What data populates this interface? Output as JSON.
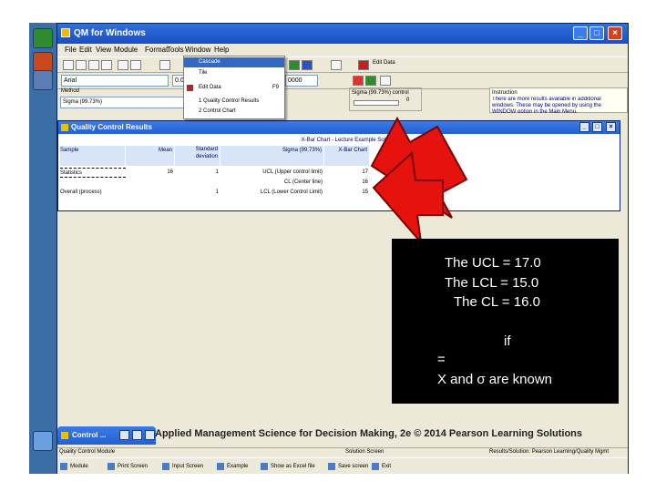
{
  "app": {
    "title": "QM for Windows",
    "menu": [
      "File",
      "Edit",
      "View",
      "Module",
      "Format",
      "Tools",
      "Window",
      "Help"
    ],
    "toolbar_button": "Edit Data",
    "font_combo": "Arial",
    "format_combo_1": "0.0",
    "format_combo_2": "0000"
  },
  "window_menu": {
    "items": [
      "Cascade",
      "Tile",
      "Edit Data",
      "1 Quality Control Results",
      "2 Control Chart"
    ],
    "edit_data_shortcut": "F9"
  },
  "method": {
    "label": "Method",
    "value": "Sigma (99.73%)"
  },
  "sigma_panel": {
    "label": "Sigma (99.73%) control",
    "value": "0"
  },
  "instruction": {
    "label": "Instruction",
    "text": "There are more results available in additional windows. These may be opened by using the WINDOW option in the Main Menu."
  },
  "qc_window": {
    "title": "Quality Control Results",
    "subtitle": "X-Bar Chart - Lecture Example Solution",
    "columns": [
      "Sample",
      "Mean",
      "Standard deviation",
      "Sigma (99.73%)",
      "X-Bar Chart"
    ],
    "rows": [
      [
        "Statistics",
        "16",
        "1",
        "UCL (Upper control limit)",
        "17"
      ],
      [
        "",
        "",
        "",
        "CL (Center line)",
        "16"
      ],
      [
        "Overall (process)",
        "",
        "1",
        "LCL (Lower Control Limit)",
        "15"
      ]
    ]
  },
  "minimized_tab": "Control ...",
  "credit": "Applied Management Science for Decision Making, 2e © 2014 Pearson Learning Solutions",
  "statusbar": {
    "left": "Quality Control Module",
    "middle": "Solution Screen",
    "right": "Results/Solution: Pearson Learning/Quality Mgmt"
  },
  "taskbar": [
    "Module",
    "Print Screen",
    "Input Screen",
    "Example",
    "Show as Excel file",
    "Save screen",
    "Exit"
  ],
  "annotation": {
    "ucl": "The UCL = 17.0",
    "lcl": "The LCL = 15.0",
    "cl": "The CL = 16.0",
    "if": "if",
    "eq": "=",
    "known": "X   and σ  are known"
  },
  "colors": {
    "arrow_fill": "#e5120e",
    "arrow_stroke": "#7a0000",
    "titlebar": "#2457d0",
    "annotation_bg": "#000000",
    "annotation_text": "#ffffff"
  }
}
